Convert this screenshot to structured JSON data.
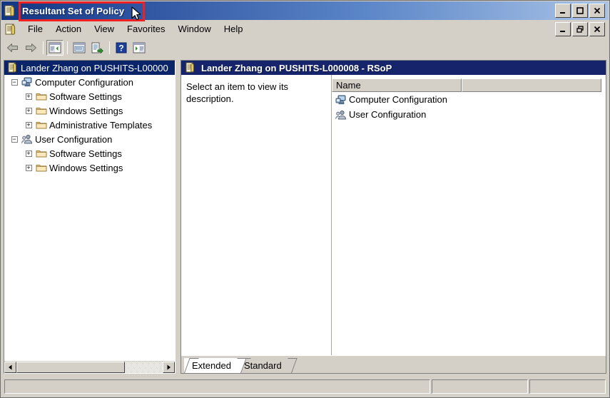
{
  "window": {
    "title": "Resultant Set of Policy",
    "app_icon": "rsop-document-icon",
    "buttons": {
      "minimize": "_",
      "maximize": "❑",
      "close": "✕"
    }
  },
  "annotation": {
    "highlight_color": "#ee2222",
    "target": "title-bar-text",
    "cursor": "mouse-pointer"
  },
  "menubar": {
    "icon": "rsop-document-icon",
    "items": [
      {
        "label": "File"
      },
      {
        "label": "Action"
      },
      {
        "label": "View"
      },
      {
        "label": "Favorites"
      },
      {
        "label": "Window"
      },
      {
        "label": "Help"
      }
    ],
    "mdi_buttons": {
      "minimize": "_",
      "restore": "❐",
      "close": "✕"
    }
  },
  "toolbar": {
    "items": [
      {
        "name": "back-button",
        "glyph": "←"
      },
      {
        "name": "forward-button",
        "glyph": "→"
      },
      {
        "name": "separator-1",
        "glyph": ""
      },
      {
        "name": "show-hide-console-tree-button",
        "glyph": ""
      },
      {
        "name": "separator-2",
        "glyph": ""
      },
      {
        "name": "properties-button",
        "glyph": ""
      },
      {
        "name": "export-list-button",
        "glyph": ""
      },
      {
        "name": "separator-3",
        "glyph": ""
      },
      {
        "name": "help-button",
        "glyph": "?"
      },
      {
        "name": "show-hide-action-pane-button",
        "glyph": ""
      }
    ]
  },
  "tree": {
    "nodes": [
      {
        "label": "Lander Zhang on PUSHITS-L00000",
        "icon": "rsop-document-icon",
        "indent": 0,
        "expander": "",
        "selected": true
      },
      {
        "label": "Computer Configuration",
        "icon": "computer-icon",
        "indent": 1,
        "expander": "−",
        "selected": false
      },
      {
        "label": "Software Settings",
        "icon": "folder-icon",
        "indent": 2,
        "expander": "+",
        "selected": false
      },
      {
        "label": "Windows Settings",
        "icon": "folder-icon",
        "indent": 2,
        "expander": "+",
        "selected": false
      },
      {
        "label": "Administrative Templates",
        "icon": "folder-icon",
        "indent": 2,
        "expander": "+",
        "selected": false
      },
      {
        "label": "User Configuration",
        "icon": "user-icon",
        "indent": 1,
        "expander": "−",
        "selected": false
      },
      {
        "label": "Software Settings",
        "icon": "folder-icon",
        "indent": 2,
        "expander": "+",
        "selected": false
      },
      {
        "label": "Windows Settings",
        "icon": "folder-icon",
        "indent": 2,
        "expander": "+",
        "selected": false
      }
    ],
    "hscroll": {
      "left_arrow": "◄",
      "right_arrow": "►"
    }
  },
  "document": {
    "header": {
      "icon": "rsop-document-icon",
      "title": "Lander Zhang on PUSHITS-L000008 - RSoP"
    },
    "description": "Select an item to view its description.",
    "listview": {
      "columns": [
        {
          "label": "Name"
        },
        {
          "label": ""
        }
      ],
      "rows": [
        {
          "name": "Computer Configuration",
          "icon": "computer-icon"
        },
        {
          "name": "User Configuration",
          "icon": "user-icon"
        }
      ]
    },
    "tabs": [
      {
        "label": "Extended",
        "active": true
      },
      {
        "label": "Standard",
        "active": false
      }
    ]
  },
  "statusbar": {
    "panes": [
      {
        "text": ""
      },
      {
        "text": ""
      },
      {
        "text": ""
      }
    ]
  },
  "colors": {
    "title_gradient_start": "#12367f",
    "title_gradient_end": "#a9c3e6",
    "selection": "#0a246a",
    "doc_header": "#16256b",
    "chrome": "#d4d0c8",
    "annotation_red": "#ee2222"
  }
}
